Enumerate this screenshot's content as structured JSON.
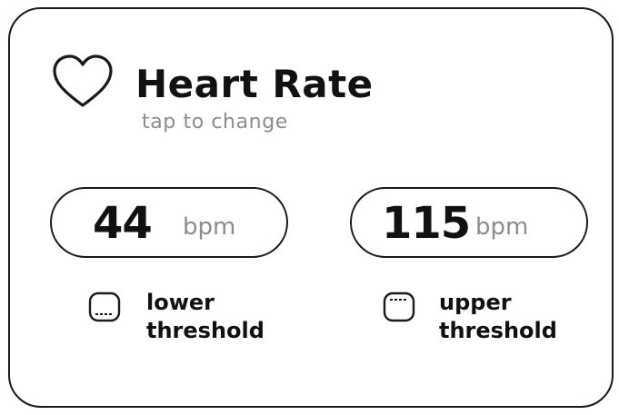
{
  "card": {
    "icon": "heart-icon",
    "title": "Heart Rate",
    "subtitle": "tap to change"
  },
  "lower": {
    "value": "44",
    "unit": "bpm",
    "icon": "lower-threshold-icon",
    "label_line1": "lower",
    "label_line2": "threshold"
  },
  "upper": {
    "value": "115",
    "unit": "bpm",
    "icon": "upper-threshold-icon",
    "label_line1": "upper",
    "label_line2": "threshold"
  },
  "colors": {
    "outline": "#1a1a1a",
    "text": "#111111",
    "muted": "#8c8c8c",
    "background": "#ffffff"
  }
}
